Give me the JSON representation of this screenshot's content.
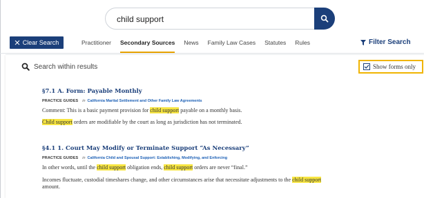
{
  "search": {
    "query": "child support"
  },
  "toolbar": {
    "clear_label": "Clear Search",
    "tabs": [
      {
        "label": "Practitioner",
        "active": false
      },
      {
        "label": "Secondary Sources",
        "active": true
      },
      {
        "label": "News",
        "active": false
      },
      {
        "label": "Family Law Cases",
        "active": false
      },
      {
        "label": "Statutes",
        "active": false
      },
      {
        "label": "Rules",
        "active": false
      }
    ],
    "filter_label": "Filter Search"
  },
  "results_header": {
    "search_within_label": "Search within results",
    "show_forms_label": "Show forms only",
    "show_forms_checked": true
  },
  "results": [
    {
      "title": "§7.1 A. Form: Payable Monthly",
      "kind": "PRACTICE GUIDES",
      "in": "in",
      "book": "California Marital Settlement and Other Family Law Agreements",
      "snippets": [
        [
          "Comment: This is a basic payment provision for ",
          "child support",
          " payable on a monthly basis."
        ],
        [
          "",
          "Child support",
          " orders are modifiable by the court as long as jurisdiction has not terminated."
        ]
      ]
    },
    {
      "title": "§4.1 1. Court May Modify or Terminate Support “As Necessary”",
      "kind": "PRACTICE GUIDES",
      "in": "in",
      "book": "California Child and Spousal Support: Establishing, Modifying, and Enforcing",
      "snippets": [
        [
          "In other words, until the ",
          "child support",
          " obligation ends, ",
          "child support",
          " orders are never “final.”"
        ],
        [
          "Incomes fluctuate, custodial timeshares change, and other circumstances arise that necessitate adjustments to the ",
          "child support",
          ""
        ],
        [
          "amount.",
          "",
          ""
        ]
      ]
    }
  ],
  "colors": {
    "brand_navy": "#1b3f7a",
    "tab_underline": "#e8a200",
    "highlight": "#f7e541",
    "forms_outline": "#f0b400"
  },
  "icons": {
    "search_button": "search-icon",
    "clear": "close-icon",
    "filter": "filter-icon",
    "within": "search-icon",
    "forms": "checkbox-checked-icon"
  }
}
